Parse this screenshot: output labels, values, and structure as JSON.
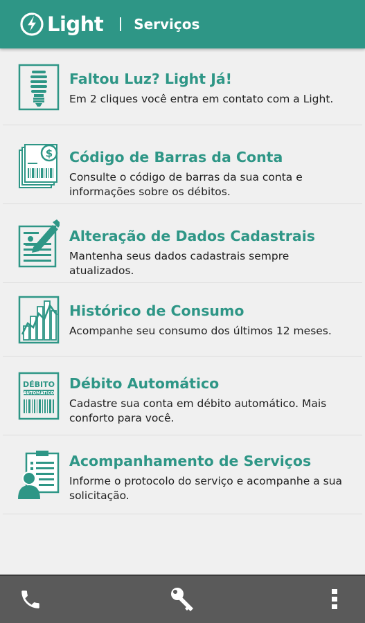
{
  "header": {
    "brand": "Light",
    "title": "Serviços",
    "color": "#2e9686"
  },
  "items": [
    {
      "icon": "lightbulb-icon",
      "title": "Faltou Luz? Light Já!",
      "description": "Em 2 cliques você entra em contato com a Light."
    },
    {
      "icon": "barcode-bill-icon",
      "title": "Código de Barras da Conta",
      "description": "Consulte o código de barras da sua conta e informações sobre os débitos."
    },
    {
      "icon": "edit-form-icon",
      "title": "Alteração de Dados Cadastrais",
      "description": "Mantenha seus dados cadastrais sempre atualizados."
    },
    {
      "icon": "bar-chart-icon",
      "title": "Histórico de Consumo",
      "description": "Acompanhe seu consumo dos últimos 12 meses."
    },
    {
      "icon": "auto-debit-icon",
      "title": "Débito Automático",
      "description": "Cadastre sua conta em débito automático. Mais conforto para você.",
      "icon_text_top": "DÉBITO",
      "icon_text_bottom": "AUTOMÁTICO"
    },
    {
      "icon": "clipboard-person-icon",
      "title": "Acompanhamento de Serviços",
      "description": "Informe o protocolo do serviço e acompanhe a sua solicitação."
    }
  ],
  "bottom_bar": {
    "buttons": [
      "phone-icon",
      "key-icon",
      "overflow-menu-icon"
    ]
  }
}
